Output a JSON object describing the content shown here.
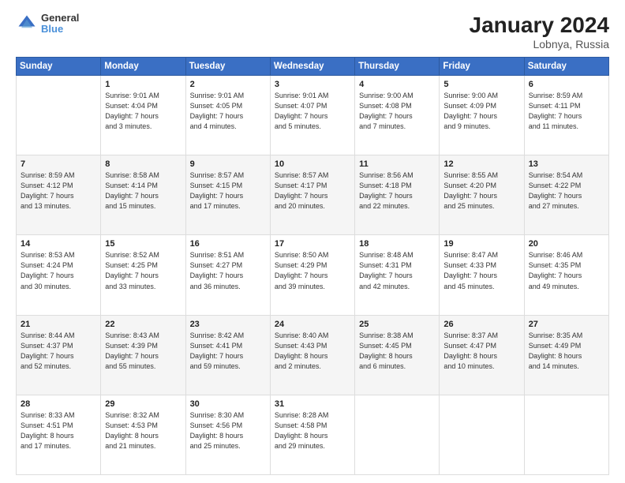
{
  "logo": {
    "line1": "General",
    "line2": "Blue"
  },
  "title": "January 2024",
  "location": "Lobnya, Russia",
  "days_of_week": [
    "Sunday",
    "Monday",
    "Tuesday",
    "Wednesday",
    "Thursday",
    "Friday",
    "Saturday"
  ],
  "weeks": [
    [
      {
        "day": "",
        "info": ""
      },
      {
        "day": "1",
        "info": "Sunrise: 9:01 AM\nSunset: 4:04 PM\nDaylight: 7 hours\nand 3 minutes."
      },
      {
        "day": "2",
        "info": "Sunrise: 9:01 AM\nSunset: 4:05 PM\nDaylight: 7 hours\nand 4 minutes."
      },
      {
        "day": "3",
        "info": "Sunrise: 9:01 AM\nSunset: 4:07 PM\nDaylight: 7 hours\nand 5 minutes."
      },
      {
        "day": "4",
        "info": "Sunrise: 9:00 AM\nSunset: 4:08 PM\nDaylight: 7 hours\nand 7 minutes."
      },
      {
        "day": "5",
        "info": "Sunrise: 9:00 AM\nSunset: 4:09 PM\nDaylight: 7 hours\nand 9 minutes."
      },
      {
        "day": "6",
        "info": "Sunrise: 8:59 AM\nSunset: 4:11 PM\nDaylight: 7 hours\nand 11 minutes."
      }
    ],
    [
      {
        "day": "7",
        "info": ""
      },
      {
        "day": "8",
        "info": "Sunrise: 8:58 AM\nSunset: 4:14 PM\nDaylight: 7 hours\nand 15 minutes."
      },
      {
        "day": "9",
        "info": "Sunrise: 8:57 AM\nSunset: 4:15 PM\nDaylight: 7 hours\nand 17 minutes."
      },
      {
        "day": "10",
        "info": "Sunrise: 8:57 AM\nSunset: 4:17 PM\nDaylight: 7 hours\nand 20 minutes."
      },
      {
        "day": "11",
        "info": "Sunrise: 8:56 AM\nSunset: 4:18 PM\nDaylight: 7 hours\nand 22 minutes."
      },
      {
        "day": "12",
        "info": "Sunrise: 8:55 AM\nSunset: 4:20 PM\nDaylight: 7 hours\nand 25 minutes."
      },
      {
        "day": "13",
        "info": "Sunrise: 8:54 AM\nSunset: 4:22 PM\nDaylight: 7 hours\nand 27 minutes."
      }
    ],
    [
      {
        "day": "14",
        "info": ""
      },
      {
        "day": "15",
        "info": "Sunrise: 8:52 AM\nSunset: 4:25 PM\nDaylight: 7 hours\nand 33 minutes."
      },
      {
        "day": "16",
        "info": "Sunrise: 8:51 AM\nSunset: 4:27 PM\nDaylight: 7 hours\nand 36 minutes."
      },
      {
        "day": "17",
        "info": "Sunrise: 8:50 AM\nSunset: 4:29 PM\nDaylight: 7 hours\nand 39 minutes."
      },
      {
        "day": "18",
        "info": "Sunrise: 8:48 AM\nSunset: 4:31 PM\nDaylight: 7 hours\nand 42 minutes."
      },
      {
        "day": "19",
        "info": "Sunrise: 8:47 AM\nSunset: 4:33 PM\nDaylight: 7 hours\nand 45 minutes."
      },
      {
        "day": "20",
        "info": "Sunrise: 8:46 AM\nSunset: 4:35 PM\nDaylight: 7 hours\nand 49 minutes."
      }
    ],
    [
      {
        "day": "21",
        "info": ""
      },
      {
        "day": "22",
        "info": "Sunrise: 8:43 AM\nSunset: 4:39 PM\nDaylight: 7 hours\nand 55 minutes."
      },
      {
        "day": "23",
        "info": "Sunrise: 8:42 AM\nSunset: 4:41 PM\nDaylight: 7 hours\nand 59 minutes."
      },
      {
        "day": "24",
        "info": "Sunrise: 8:40 AM\nSunset: 4:43 PM\nDaylight: 8 hours\nand 2 minutes."
      },
      {
        "day": "25",
        "info": "Sunrise: 8:38 AM\nSunset: 4:45 PM\nDaylight: 8 hours\nand 6 minutes."
      },
      {
        "day": "26",
        "info": "Sunrise: 8:37 AM\nSunset: 4:47 PM\nDaylight: 8 hours\nand 10 minutes."
      },
      {
        "day": "27",
        "info": "Sunrise: 8:35 AM\nSunset: 4:49 PM\nDaylight: 8 hours\nand 14 minutes."
      }
    ],
    [
      {
        "day": "28",
        "info": ""
      },
      {
        "day": "29",
        "info": "Sunrise: 8:32 AM\nSunset: 4:53 PM\nDaylight: 8 hours\nand 21 minutes."
      },
      {
        "day": "30",
        "info": "Sunrise: 8:30 AM\nSunset: 4:56 PM\nDaylight: 8 hours\nand 25 minutes."
      },
      {
        "day": "31",
        "info": "Sunrise: 8:28 AM\nSunset: 4:58 PM\nDaylight: 8 hours\nand 29 minutes."
      },
      {
        "day": "",
        "info": ""
      },
      {
        "day": "",
        "info": ""
      },
      {
        "day": "",
        "info": ""
      }
    ]
  ],
  "week1_sun_info": "Sunrise: 8:59 AM\nSunset: 4:12 PM\nDaylight: 7 hours\nand 13 minutes.",
  "week2_sun_info": "Sunrise: 8:53 AM\nSunset: 4:24 PM\nDaylight: 7 hours\nand 30 minutes.",
  "week3_sun_info": "Sunrise: 8:44 AM\nSunset: 4:37 PM\nDaylight: 7 hours\nand 52 minutes.",
  "week4_sun_info": "Sunrise: 8:33 AM\nSunset: 4:51 PM\nDaylight: 8 hours\nand 17 minutes."
}
